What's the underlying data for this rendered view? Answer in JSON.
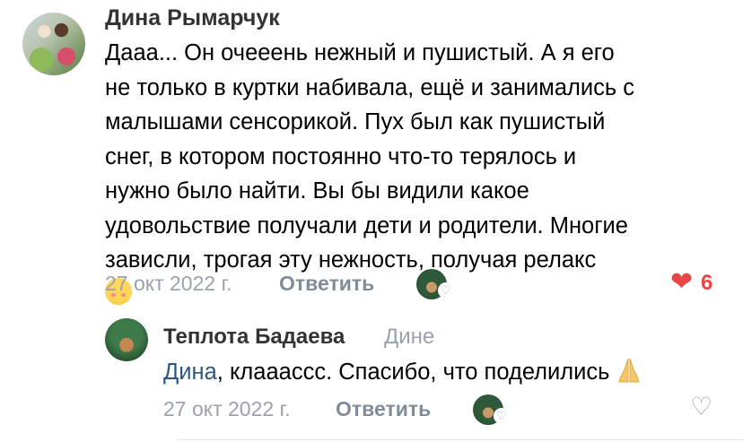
{
  "comment": {
    "author": "Дина Рымарчук",
    "lines": [
      "Дааа... Он очееень нежный и пушистый. А я его",
      "не только в куртки набивала, ещё и занимались с",
      "малышами сенсорикой. Пух  был как пушистый",
      "снег, в котором постоянно что-то терялось и",
      "нужно было найти. Вы бы видили какое",
      "удовольствие получали дети и родители. Многие",
      "зависли, трогая эту нежность, получая релакс"
    ],
    "date": "27 окт 2022 г.",
    "reply_label": "Ответить",
    "like_count": "6",
    "emoji_icon": "smiling-face-icon",
    "liked": true
  },
  "reply": {
    "author": "Теплота Бадаева",
    "to": "Дине",
    "mention": "Дина",
    "text": ", клаааccc. Спасибо, что поделились",
    "date": "27 окт 2022 г.",
    "reply_label": "Ответить",
    "emoji_icon": "folded-hands-icon",
    "liked": false
  },
  "colors": {
    "meta": "#99a2ad",
    "reply_button": "#818c99",
    "like_red": "#e64646",
    "mention": "#2a5885"
  }
}
